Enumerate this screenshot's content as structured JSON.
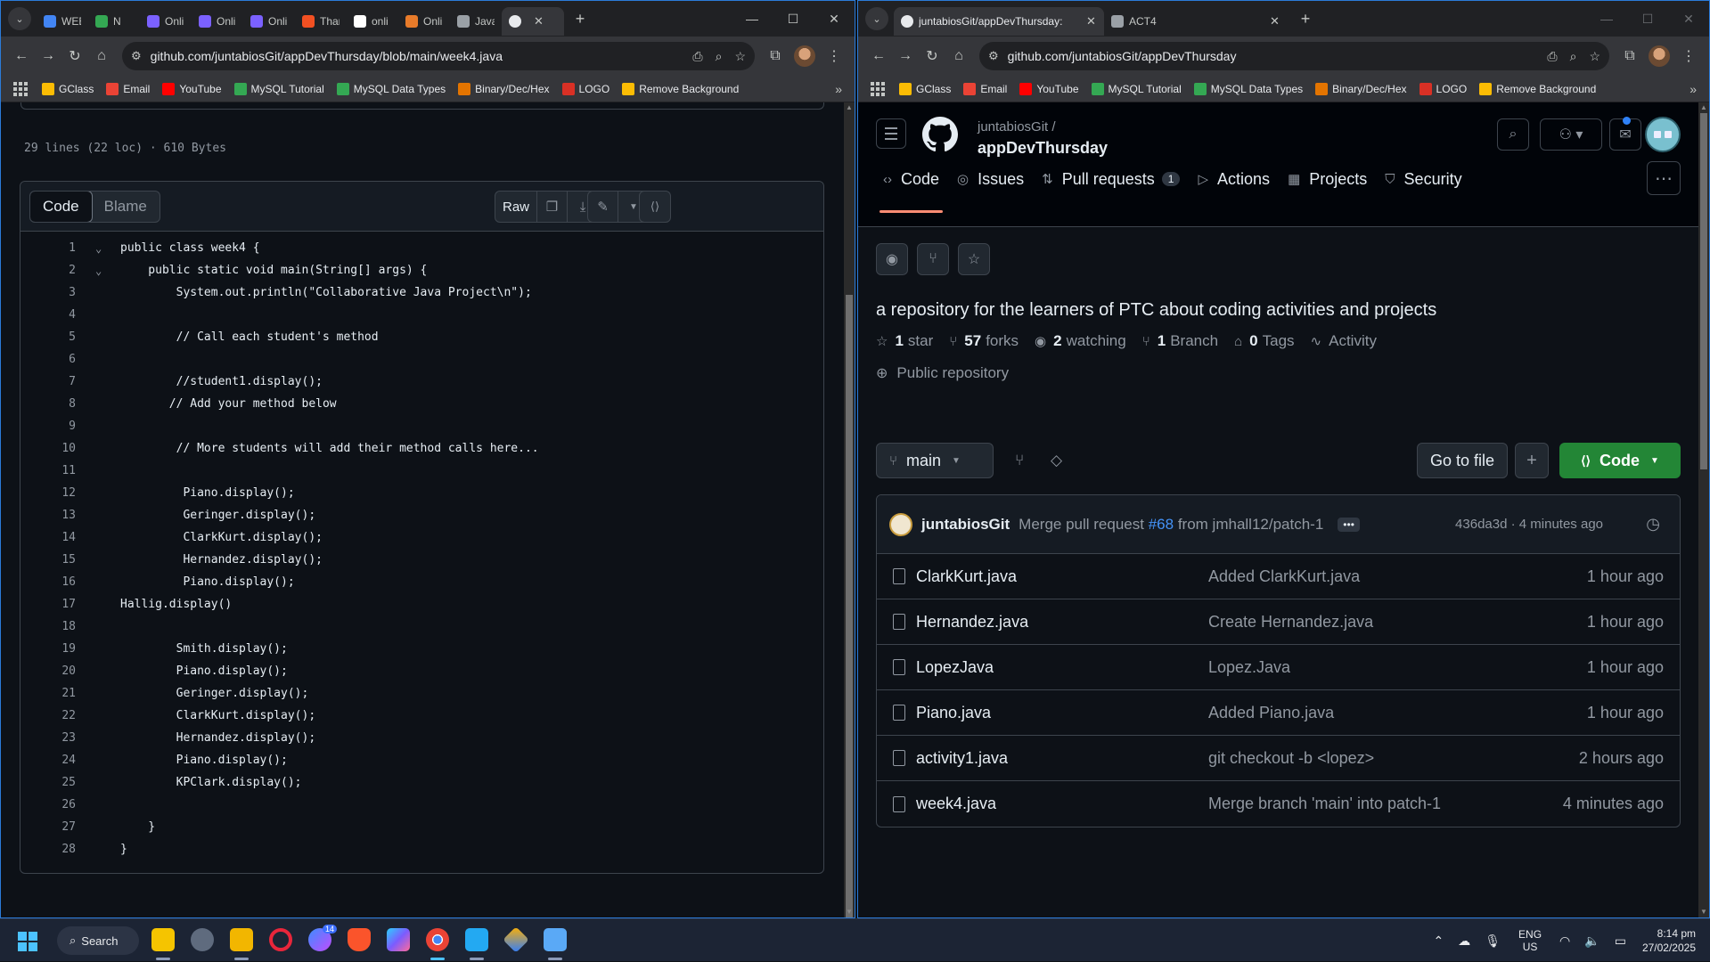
{
  "left_window": {
    "tabs": [
      {
        "label": "WEE",
        "color": "#4285f4"
      },
      {
        "label": "N",
        "color": "#34a853"
      },
      {
        "label": "Onli",
        "color": "#7b61ff"
      },
      {
        "label": "Onli",
        "color": "#7b61ff"
      },
      {
        "label": "Onli",
        "color": "#7b61ff"
      },
      {
        "label": "Thar",
        "color": "#f25022"
      },
      {
        "label": "onli",
        "color": "#ffffff"
      },
      {
        "label": "Onli",
        "color": "#e87b2a"
      },
      {
        "label": "Java",
        "color": "#9aa0a6"
      }
    ],
    "active_tab_icon": "github-icon",
    "url": "github.com/juntabiosGit/appDevThursday/blob/main/week4.java",
    "file_meta": "29 lines (22 loc) · 610 Bytes",
    "view_tabs": {
      "code": "Code",
      "blame": "Blame"
    },
    "raw_label": "Raw",
    "code_lines": [
      {
        "n": "1",
        "text": "public class week4 {",
        "fold": true
      },
      {
        "n": "2",
        "text": "    public static void main(String[] args) {",
        "fold": true
      },
      {
        "n": "3",
        "text": "        System.out.println(\"Collaborative Java Project\\n\");",
        "fold": false
      },
      {
        "n": "4",
        "text": "",
        "fold": false
      },
      {
        "n": "5",
        "text": "        // Call each student's method",
        "fold": false
      },
      {
        "n": "6",
        "text": "",
        "fold": false
      },
      {
        "n": "7",
        "text": "        //student1.display();",
        "fold": false
      },
      {
        "n": "8",
        "text": "       // Add your method below",
        "fold": false
      },
      {
        "n": "9",
        "text": "",
        "fold": false
      },
      {
        "n": "10",
        "text": "        // More students will add their method calls here...",
        "fold": false
      },
      {
        "n": "11",
        "text": "",
        "fold": false
      },
      {
        "n": "12",
        "text": "         Piano.display();",
        "fold": false
      },
      {
        "n": "13",
        "text": "         Geringer.display();",
        "fold": false
      },
      {
        "n": "14",
        "text": "         ClarkKurt.display();",
        "fold": false
      },
      {
        "n": "15",
        "text": "         Hernandez.display();",
        "fold": false
      },
      {
        "n": "16",
        "text": "         Piano.display();",
        "fold": false
      },
      {
        "n": "17",
        "text": "Hallig.display()",
        "fold": false
      },
      {
        "n": "18",
        "text": "",
        "fold": false
      },
      {
        "n": "19",
        "text": "        Smith.display();",
        "fold": false
      },
      {
        "n": "20",
        "text": "        Piano.display();",
        "fold": false
      },
      {
        "n": "21",
        "text": "        Geringer.display();",
        "fold": false
      },
      {
        "n": "22",
        "text": "        ClarkKurt.display();",
        "fold": false
      },
      {
        "n": "23",
        "text": "        Hernandez.display();",
        "fold": false
      },
      {
        "n": "24",
        "text": "        Piano.display();",
        "fold": false
      },
      {
        "n": "25",
        "text": "        KPClark.display();",
        "fold": false
      },
      {
        "n": "26",
        "text": "",
        "fold": false
      },
      {
        "n": "27",
        "text": "    }",
        "fold": false
      },
      {
        "n": "28",
        "text": "}",
        "fold": false
      }
    ]
  },
  "right_window": {
    "tabs": [
      {
        "label": "juntabiosGit/appDevThursday:",
        "icon": "github-icon",
        "active": true
      },
      {
        "label": "ACT4",
        "icon": "image-icon",
        "active": false
      }
    ],
    "url": "github.com/juntabiosGit/appDevThursday",
    "owner": "juntabiosGit /",
    "repo": "appDevThursday",
    "nav": [
      {
        "label": "Code",
        "icon": "code-icon",
        "selected": true,
        "badge": ""
      },
      {
        "label": "Issues",
        "icon": "issue-icon",
        "selected": false,
        "badge": ""
      },
      {
        "label": "Pull requests",
        "icon": "pull-request-icon",
        "selected": false,
        "badge": "1"
      },
      {
        "label": "Actions",
        "icon": "play-icon",
        "selected": false,
        "badge": ""
      },
      {
        "label": "Projects",
        "icon": "table-icon",
        "selected": false,
        "badge": ""
      },
      {
        "label": "Security",
        "icon": "shield-icon",
        "selected": false,
        "badge": ""
      }
    ],
    "description": "a repository for the learners of PTC about coding activities and projects",
    "stats": {
      "stars_n": "1",
      "stars_l": "star",
      "forks_n": "57",
      "forks_l": "forks",
      "watch_n": "2",
      "watch_l": "watching",
      "branch_n": "1",
      "branch_l": "Branch",
      "tags_n": "0",
      "tags_l": "Tags",
      "activity_l": "Activity"
    },
    "visibility": "Public repository",
    "branch": "main",
    "goto_file": "Go to file",
    "code_button": "Code",
    "commit": {
      "user": "juntabiosGit",
      "msg_prefix": "Merge pull request",
      "pr": "#68",
      "msg_suffix": "from jmhall12/patch-1",
      "hash_time": "436da3d · 4 minutes ago"
    },
    "files": [
      {
        "name": "ClarkKurt.java",
        "msg": "Added ClarkKurt.java",
        "time": "1 hour ago"
      },
      {
        "name": "Hernandez.java",
        "msg": "Create Hernandez.java",
        "time": "1 hour ago"
      },
      {
        "name": "LopezJava",
        "msg": "Lopez.Java",
        "time": "1 hour ago"
      },
      {
        "name": "Piano.java",
        "msg": "Added Piano.java",
        "time": "1 hour ago"
      },
      {
        "name": "activity1.java",
        "msg": "git checkout -b <lopez>",
        "time": "2 hours ago"
      },
      {
        "name": "week4.java",
        "msg": "Merge branch 'main' into patch-1",
        "time": "4 minutes ago"
      }
    ]
  },
  "bookmarks": [
    {
      "label": "GClass",
      "color": "#fbbc04"
    },
    {
      "label": "Email",
      "color": "#ea4335"
    },
    {
      "label": "YouTube",
      "color": "#ff0000"
    },
    {
      "label": "MySQL Tutorial",
      "color": "#34a853"
    },
    {
      "label": "MySQL Data Types",
      "color": "#34a853"
    },
    {
      "label": "Binary/Dec/Hex",
      "color": "#e37400"
    },
    {
      "label": "LOGO",
      "color": "#d93025"
    },
    {
      "label": "Remove Background",
      "color": "#fbbc04"
    }
  ],
  "taskbar": {
    "search": "Search",
    "messenger_badge": "14",
    "lang1": "ENG",
    "lang2": "US",
    "time": "8:14 pm",
    "date": "27/02/2025"
  }
}
